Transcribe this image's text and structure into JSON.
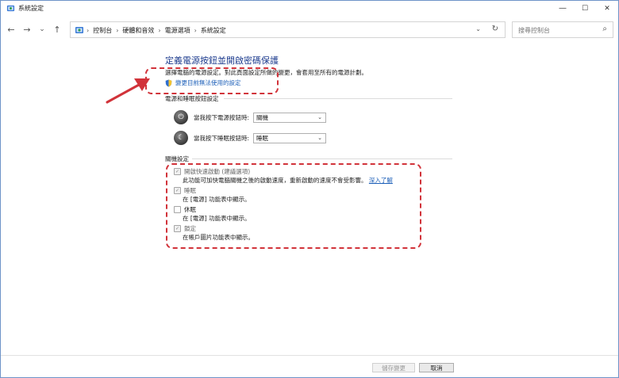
{
  "window": {
    "title": "系統設定",
    "buttons": {
      "minimize": "—",
      "maximize": "☐",
      "close": "✕"
    }
  },
  "nav": {
    "back": "←",
    "forward": "→",
    "recent": "⌄",
    "up": "↑",
    "breadcrumbs": [
      "控制台",
      "硬體和音效",
      "電源選項",
      "系統設定"
    ],
    "search_placeholder": "搜尋控制台"
  },
  "main": {
    "heading": "定義電源按鈕並開啟密碼保護",
    "description": "選擇電腦的電源設定。對此頁面設定所做的變更，會套用至所有的電源計劃。",
    "change_link": "變更目前無法使用的設定",
    "power_section": {
      "title": "電源和睡眠按鈕設定",
      "rows": [
        {
          "label": "當我按下電源按鈕時:",
          "value": "關機",
          "icon": "power-icon"
        },
        {
          "label": "當我按下睡眠按鈕時:",
          "value": "睡眠",
          "icon": "moon-icon"
        }
      ]
    },
    "shutdown_section": {
      "title": "關機設定",
      "options": [
        {
          "label": "開啟快速啟動 (建議選項)",
          "checked": true,
          "desc": "此功能可加快電腦關機之後的啟動速度，重新啟動的速度不會受影響。",
          "link": "深入了解"
        },
        {
          "label": "睡眠",
          "checked": true,
          "desc": "在 [電源] 功能表中顯示。",
          "link": ""
        },
        {
          "label": "休眠",
          "checked": false,
          "desc": "在 [電源] 功能表中顯示。",
          "link": ""
        },
        {
          "label": "鎖定",
          "checked": true,
          "desc": "在帳戶圖片功能表中顯示。",
          "link": ""
        }
      ]
    }
  },
  "footer": {
    "save_label": "儲存變更",
    "cancel_label": "取消"
  },
  "colors": {
    "heading": "#1e3d8f",
    "link": "#1c5fb8",
    "annotation": "#d1333a"
  }
}
